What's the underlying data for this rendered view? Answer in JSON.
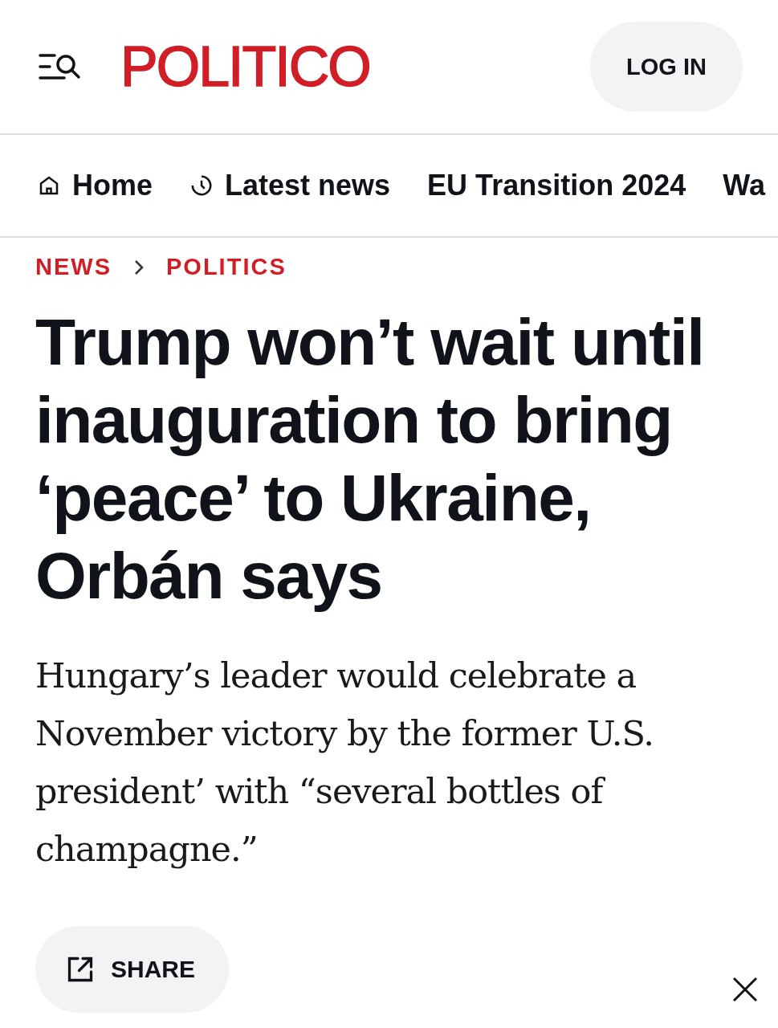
{
  "header": {
    "logo": "POLITICO",
    "login_button": "LOG IN"
  },
  "nav": [
    {
      "label": "Home",
      "kind": "home"
    },
    {
      "label": "Latest news",
      "kind": "clock"
    },
    {
      "label": "EU Transition 2024",
      "kind": "plain"
    },
    {
      "label": "Wa",
      "kind": "plain"
    }
  ],
  "breadcrumb": [
    "NEWS",
    "POLITICS"
  ],
  "headline": "Trump won’t wait until inauguration to bring ‘peace’ to Ukraine, Orbán says",
  "dek": "Hungary’s leader would celebrate a November victory by the former U.S. president’ with “several bottles of champagne.”",
  "share_button": "SHARE"
}
